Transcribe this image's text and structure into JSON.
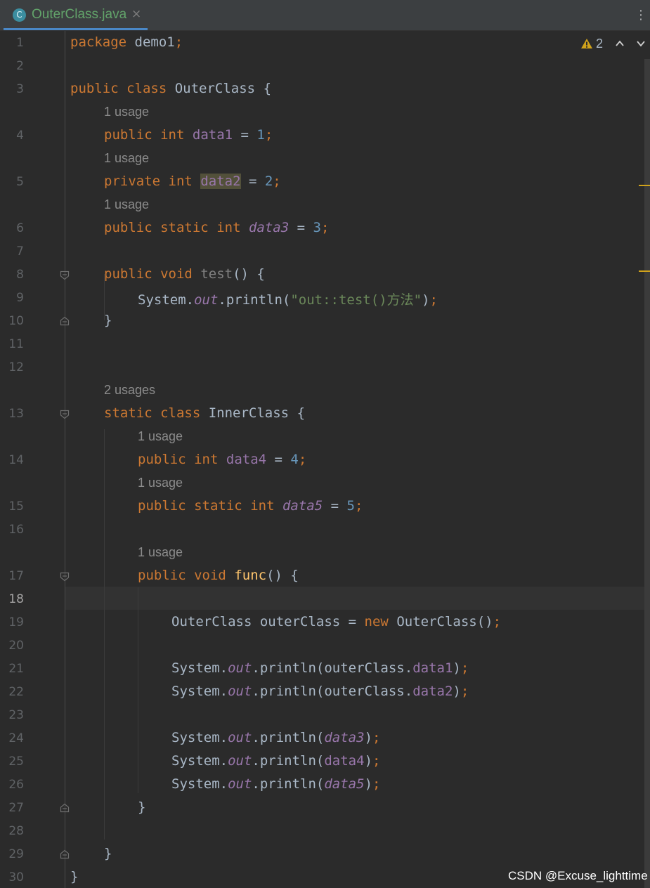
{
  "tab": {
    "icon_letter": "C",
    "title": "OuterClass.java",
    "close_glyph": "×",
    "menu_glyph": "⋮"
  },
  "inspections": {
    "warning_count": "2",
    "warning_icon": "warning-triangle-icon",
    "warning_color": "#d0a21b"
  },
  "line_numbers": [
    "1",
    "2",
    "3",
    "4",
    "5",
    "6",
    "7",
    "8",
    "9",
    "10",
    "11",
    "12",
    "13",
    "14",
    "15",
    "16",
    "17",
    "18",
    "19",
    "20",
    "21",
    "22",
    "23",
    "24",
    "25",
    "26",
    "27",
    "28",
    "29",
    "30"
  ],
  "current_line": "18",
  "code": {
    "l1": {
      "kw": "package",
      "text": " demo1",
      "semi": ";"
    },
    "l3": {
      "kw1": "public",
      "kw2": "class",
      "name": " OuterClass {"
    },
    "hint_4": "1 usage",
    "l4": {
      "kw1": "public",
      "kw2": "int",
      "field": "data1",
      "eq": " = ",
      "num": "1",
      "semi": ";"
    },
    "hint_5": "1 usage",
    "l5": {
      "kw1": "private",
      "kw2": "int",
      "field": "data2",
      "eq": " = ",
      "num": "2",
      "semi": ";"
    },
    "hint_6": "1 usage",
    "l6": {
      "kw1": "public",
      "kw2": "static",
      "kw3": "int",
      "field": "data3",
      "eq": " = ",
      "num": "3",
      "semi": ";"
    },
    "l8": {
      "kw1": "public",
      "kw2": "void",
      "method": "test",
      "rest": "() {"
    },
    "l9": {
      "obj": "System.",
      "out": "out",
      "call": ".println(",
      "str": "\"out::test()方法\"",
      "close": ")",
      "semi": ";"
    },
    "l10": "}",
    "hint_13": "2 usages",
    "l13": {
      "kw1": "static",
      "kw2": "class",
      "name": " InnerClass {"
    },
    "hint_14": "1 usage",
    "l14": {
      "kw1": "public",
      "kw2": "int",
      "field": "data4",
      "eq": " = ",
      "num": "4",
      "semi": ";"
    },
    "hint_15": "1 usage",
    "l15": {
      "kw1": "public",
      "kw2": "static",
      "kw3": "int",
      "field": "data5",
      "eq": " = ",
      "num": "5",
      "semi": ";"
    },
    "hint_17": "1 usage",
    "l17": {
      "kw1": "public",
      "kw2": "void",
      "method": "func",
      "rest": "() {"
    },
    "l19": {
      "type": "OuterClass outerClass = ",
      "kw": "new",
      "ctor": " OuterClass()",
      "semi": ";"
    },
    "l21": {
      "obj": "System.",
      "out": "out",
      "call": ".println(outerClass.",
      "field": "data1",
      "close": ")",
      "semi": ";"
    },
    "l22": {
      "obj": "System.",
      "out": "out",
      "call": ".println(outerClass.",
      "field": "data2",
      "close": ")",
      "semi": ";"
    },
    "l24": {
      "obj": "System.",
      "out": "out",
      "call": ".println(",
      "field": "data3",
      "close": ")",
      "semi": ";"
    },
    "l25": {
      "obj": "System.",
      "out": "out",
      "call": ".println(",
      "field": "data4",
      "close": ")",
      "semi": ";"
    },
    "l26": {
      "obj": "System.",
      "out": "out",
      "call": ".println(",
      "field": "data5",
      "close": ")",
      "semi": ";"
    },
    "l27": "}",
    "l29": "}",
    "l30": "}"
  },
  "watermark": "CSDN @Excuse_lighttime",
  "colors": {
    "background": "#2b2b2b",
    "keyword": "#cc7832",
    "number": "#6897bb",
    "field": "#9876aa",
    "string": "#6a8759",
    "method_declaration": "#ffc66d",
    "default_text": "#a9b7c6",
    "tab_title": "#62a36a"
  }
}
